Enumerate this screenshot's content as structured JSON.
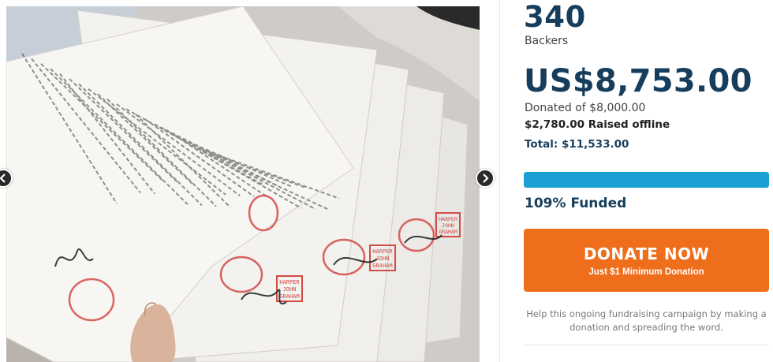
{
  "gallery": {
    "prev_icon": "chevron-left-icon",
    "next_icon": "chevron-right-icon",
    "photo_subject": "photo-of-signed-stamped-documents",
    "stamp_color": "#d24b45",
    "stamp_lines": [
      "HARPER",
      "JOHN",
      "GRAHAM"
    ]
  },
  "stats": {
    "backers_count": "340",
    "backers_label": "Backers",
    "amount_raised": "US$8,753.00",
    "goal_text": "Donated of $8,000.00",
    "offline_text": "$2,780.00 Raised offline",
    "total_text": "Total: $11,533.00",
    "progress_percent": 100,
    "funded_text": "109% Funded"
  },
  "donate": {
    "title": "DONATE NOW",
    "subtitle": "Just $1 Minimum Donation"
  },
  "help_text": "Help this ongoing fundraising campaign by making a donation and spreading the word.",
  "colors": {
    "heading": "#163e5c",
    "accent_progress": "#1aa0d2",
    "donate_button": "#ee6e1c"
  }
}
